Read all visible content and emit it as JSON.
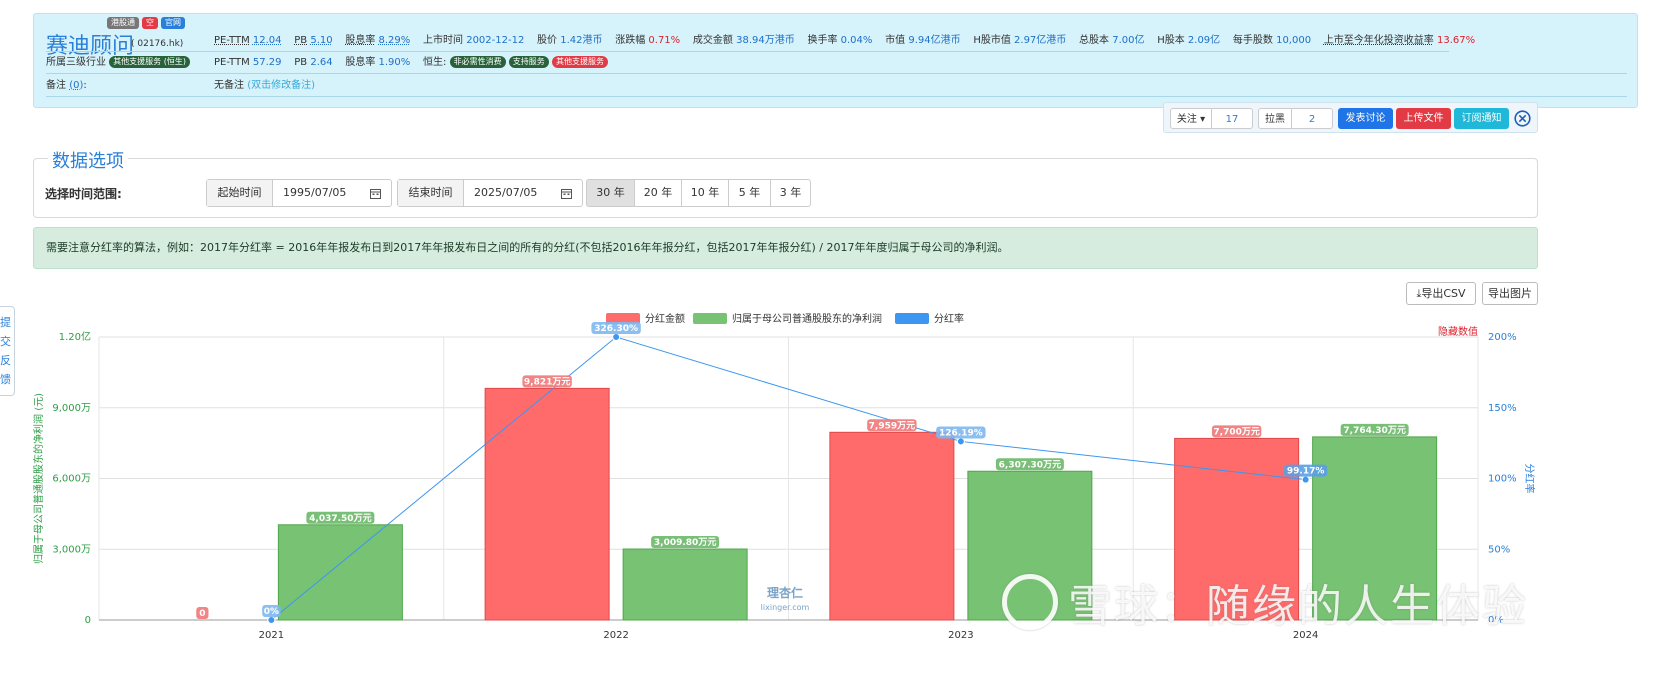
{
  "header": {
    "badges": [
      {
        "label": "港股通",
        "color": "#777777"
      },
      {
        "label": "空",
        "color": "#e23b45"
      },
      {
        "label": "官网",
        "color": "#2a7fd8"
      }
    ],
    "name": "赛迪顾问",
    "code": "( 02176.hk)",
    "row1": {
      "pe_label": "PE-TTM",
      "pe": "12.04",
      "pb_label": "PB",
      "pb": "5.10",
      "div_label": "股息率",
      "div": "8.29%",
      "list_label": "上市时间",
      "list_date": "2002-12-12",
      "price_label": "股价",
      "price": "1.42港币",
      "chg_label": "涨跌幅",
      "chg": "0.71%",
      "amount_label": "成交金额",
      "amount": "38.94万港币",
      "turnover_label": "换手率",
      "turnover": "0.04%",
      "mcap_label": "市值",
      "mcap": "9.94亿港币",
      "hmcap_label": "H股市值",
      "hmcap": "2.97亿港币",
      "shares_label": "总股本",
      "shares": "7.00亿",
      "hshares_label": "H股本",
      "hshares": "2.09亿",
      "lot_label": "每手股数",
      "lot": "10,000",
      "ret_label": "上市至今年化投资收益率",
      "ret": "13.67%"
    },
    "row2": {
      "industry_label": "所属三级行业",
      "industry_tag": "其他支援服务 (恒生)",
      "pe_label": "PE-TTM",
      "pe": "57.29",
      "pb_label": "PB",
      "pb": "2.64",
      "div_label": "股息率",
      "div": "1.90%",
      "hs_label": "恒生:",
      "hs_tags": [
        "非必需性消费",
        "支持服务",
        "其他支援服务"
      ]
    },
    "row3": {
      "note_label": "备注",
      "note_count": "(0)",
      "note_colon": ":",
      "no_note": "无备注",
      "edit_note": "(双击修改备注)"
    }
  },
  "toolbar": {
    "follow_label": "关注",
    "follow_count": "17",
    "block_label": "拉黑",
    "block_count": "2",
    "discuss": "发表讨论",
    "upload": "上传文件",
    "subscribe": "订阅通知"
  },
  "options": {
    "legend": "数据选项",
    "range_label": "选择时间范围:",
    "start_label": "起始时间",
    "start_value": "1995/07/05",
    "end_label": "结束时间",
    "end_value": "2025/07/05",
    "periods": [
      "30 年",
      "20 年",
      "10 年",
      "5 年",
      "3 年"
    ],
    "active_period": 0
  },
  "notice": "需要注意分红率的算法，例如：2017年分红率 = 2016年年报发布日到2017年年报发布日之间的所有的分红(不包括2016年年报分红，包括2017年年报分红) / 2017年年度归属于母公司的净利润。",
  "buttons": {
    "export_csv": "导出CSV",
    "export_img": "导出图片"
  },
  "feedback": [
    "提",
    "交",
    "反",
    "馈"
  ],
  "colors": {
    "dividend": "#ff6b6b",
    "profit": "#78c273",
    "ratio": "#3d96f0",
    "left_axis": "#2e9d46",
    "right_axis": "#2a7fd8"
  },
  "chart_data": {
    "type": "bar",
    "categories": [
      "2021",
      "2022",
      "2023",
      "2024"
    ],
    "legend": [
      "分红金额",
      "归属于母公司普通股股东的净利润",
      "分红率"
    ],
    "hide_values": "隐藏数值",
    "y_left_label": "归属于母公司普通股股东的净利润 (元)",
    "y_right_label": "分红率",
    "y_left_ticks": [
      "0",
      "3,000万",
      "6,000万",
      "9,000万",
      "1.20亿"
    ],
    "y_right_ticks": [
      "0%",
      "50%",
      "100%",
      "150%",
      "200%"
    ],
    "y_left_max": 120000000,
    "y_right_max": 200,
    "series": [
      {
        "name": "分红金额",
        "kind": "bar",
        "values": [
          0,
          98210000,
          79590000,
          77000000
        ],
        "labels": [
          "0",
          "9,821万元",
          "7,959万元",
          "7,700万元"
        ]
      },
      {
        "name": "归属于母公司普通股股东的净利润",
        "kind": "bar",
        "values": [
          40375000,
          30098000,
          63073000,
          77643000
        ],
        "labels": [
          "4,037.50万元",
          "3,009.80万元",
          "6,307.30万元",
          "7,764.30万元"
        ]
      },
      {
        "name": "分红率",
        "kind": "line",
        "values": [
          0,
          326.3,
          126.19,
          99.17
        ],
        "labels": [
          "0%",
          "326.30%",
          "126.19%",
          "99.17%"
        ]
      }
    ],
    "logo_text": "理杏仁",
    "logo_sub": "lixinger.com"
  },
  "watermark": "雪球：随缘的人生体验"
}
